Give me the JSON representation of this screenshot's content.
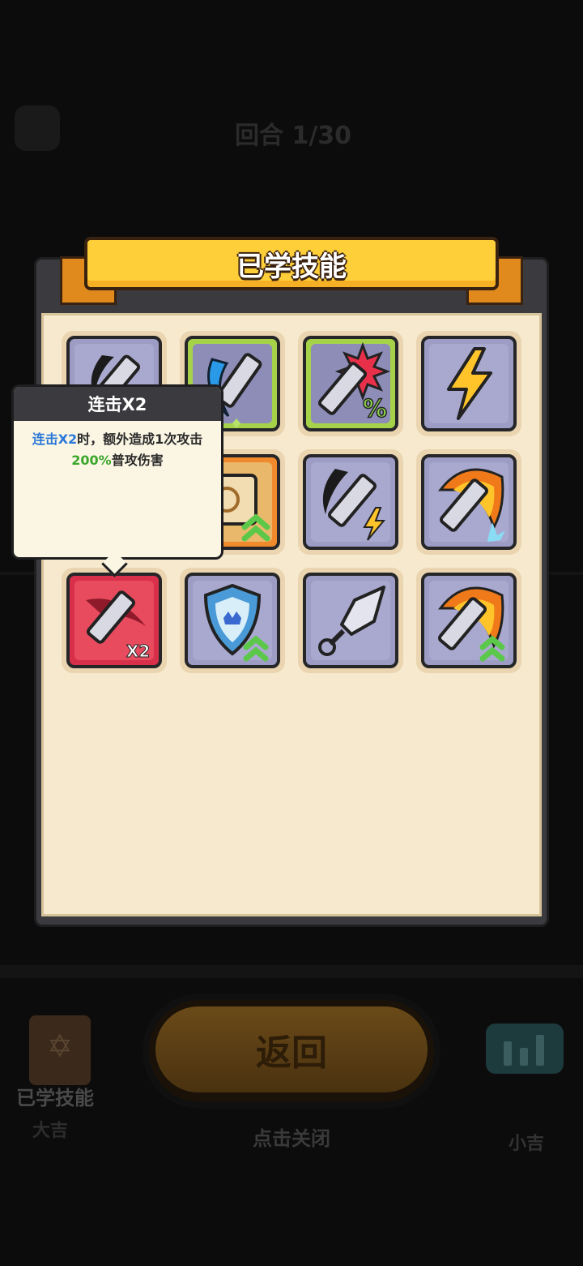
{
  "background": {
    "round_text": "回合 1/30",
    "close_hint": "点击关闭",
    "back_button_label": "返回",
    "learned_skills_label": "已学技能",
    "left_bottom_label": "大吉",
    "right_bottom_label": "小吉"
  },
  "panel": {
    "title": "已学技能"
  },
  "skills": [
    {
      "name": "skill-1",
      "icon": "sword-dark-slash-icon",
      "frame": "gray"
    },
    {
      "name": "skill-2",
      "icon": "sword-blue-slash-icon",
      "frame": "green"
    },
    {
      "name": "skill-3",
      "icon": "sword-crit-percent-icon",
      "frame": "green"
    },
    {
      "name": "skill-4",
      "icon": "lightning-icon",
      "frame": "gray"
    },
    {
      "name": "skill-5",
      "icon": "sword-hidden-icon",
      "frame": "gray"
    },
    {
      "name": "skill-6",
      "icon": "spellbook-upgrade-icon",
      "frame": "orange"
    },
    {
      "name": "skill-7",
      "icon": "sword-lightning-icon",
      "frame": "gray"
    },
    {
      "name": "skill-8",
      "icon": "sword-fire-ice-icon",
      "frame": "gray"
    },
    {
      "name": "skill-9",
      "icon": "sword-combo-x2-icon",
      "frame": "red",
      "badge": "X2"
    },
    {
      "name": "skill-10",
      "icon": "shield-upgrade-icon",
      "frame": "gray"
    },
    {
      "name": "skill-11",
      "icon": "kunai-icon",
      "frame": "gray"
    },
    {
      "name": "skill-12",
      "icon": "sword-fire-upgrade-icon",
      "frame": "gray"
    }
  ],
  "tooltip": {
    "title": "连击X2",
    "line1_highlight": "连击X2",
    "line1_rest": "时，额外造成1次攻击",
    "line2_highlight": "200%",
    "line2_rest": "普攻伤害"
  },
  "colors": {
    "ribbon": "#ffcf3a",
    "panel_bg": "#f6e9ce",
    "highlight_blue": "#2a78d8",
    "highlight_green": "#3aa62a"
  }
}
